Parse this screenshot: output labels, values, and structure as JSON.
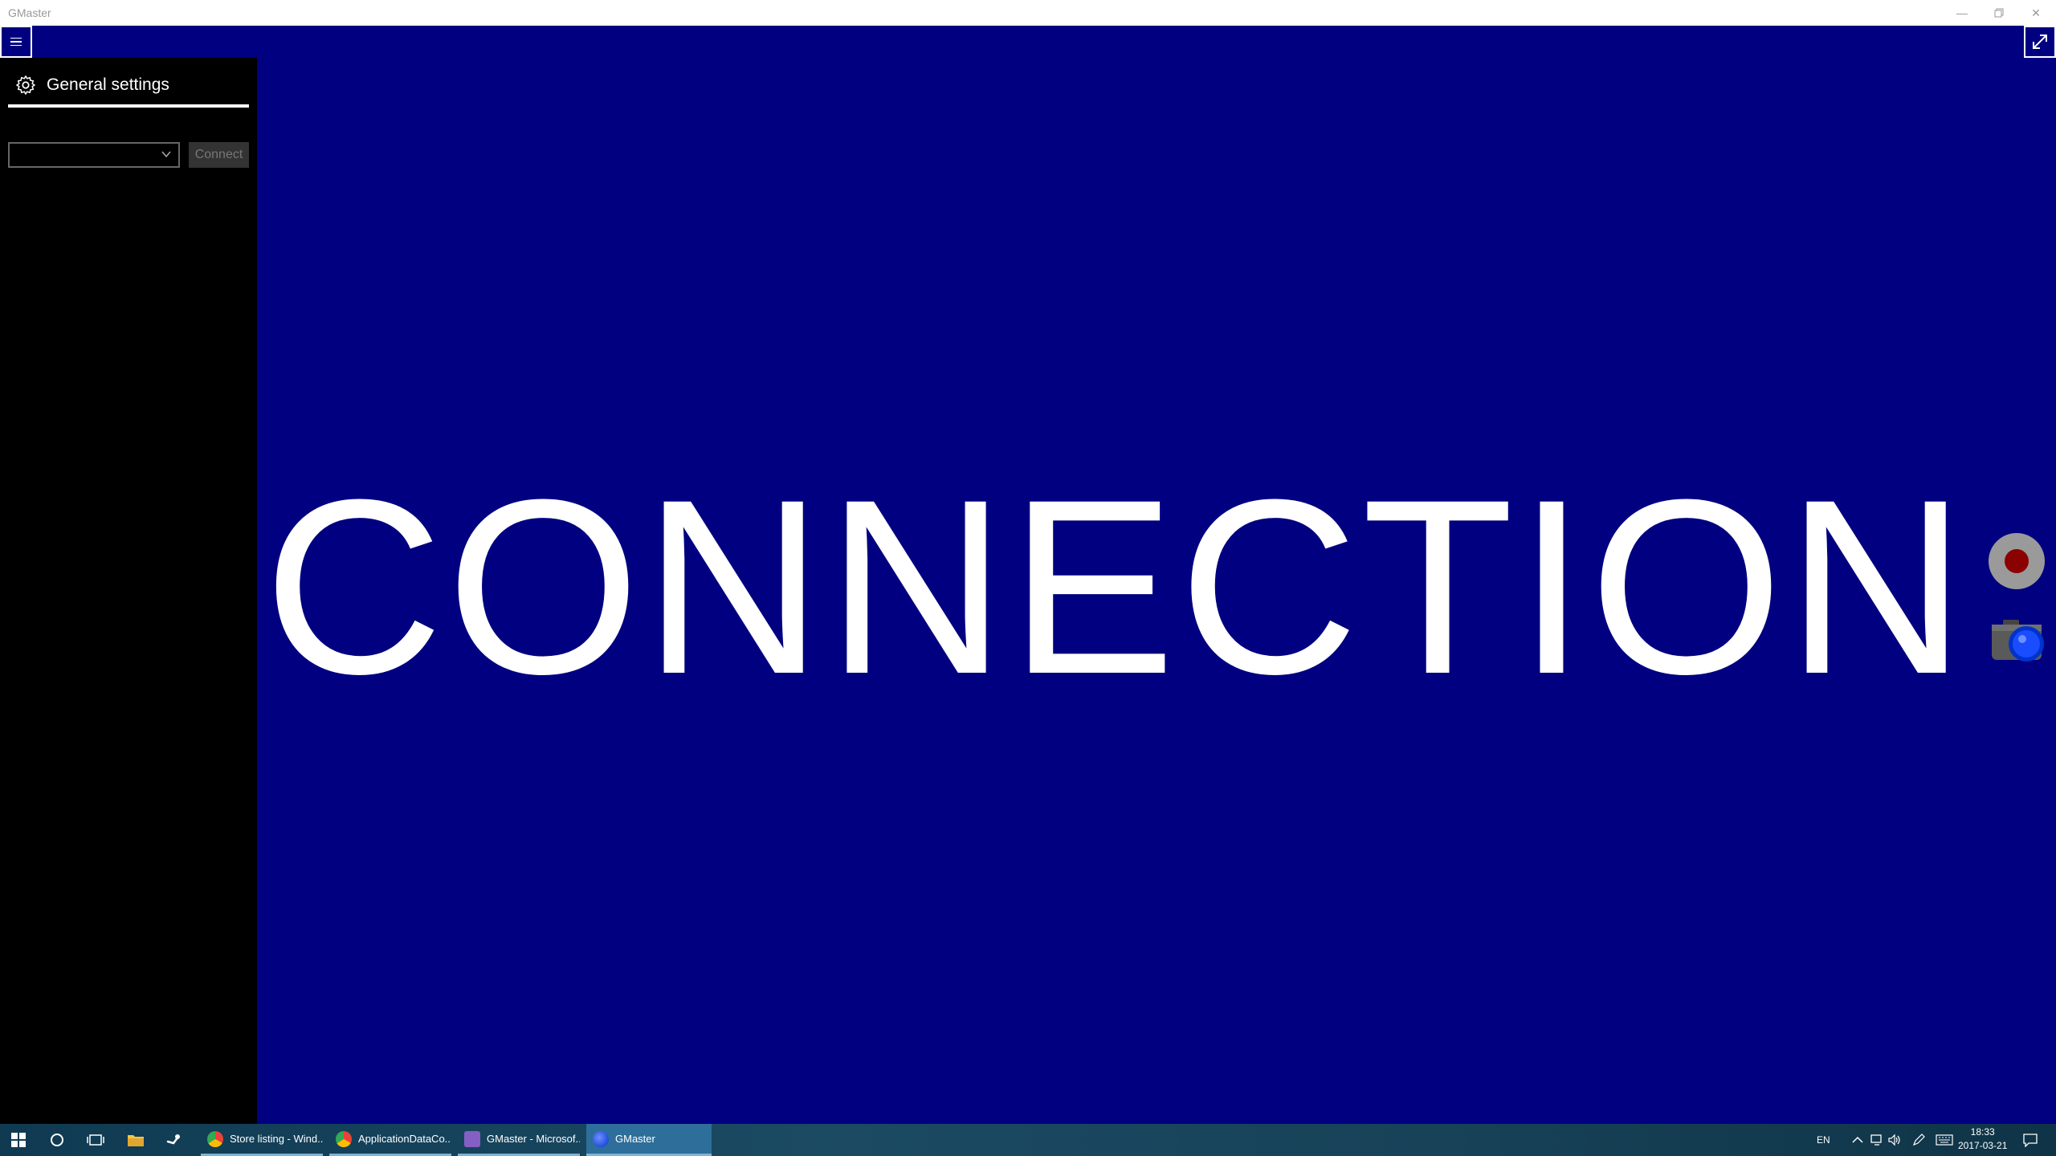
{
  "window": {
    "title": "GMaster",
    "minimize_icon": "minimize-icon",
    "maximize_icon": "restore-icon",
    "close_icon": "close-icon"
  },
  "sidepane": {
    "menu_icon": "hamburger-icon",
    "header_icon": "gear-icon",
    "header_label": "General settings",
    "device_select_value": "",
    "connect_label": "Connect"
  },
  "stage": {
    "status_text": "NO CONNECTION",
    "expand_icon": "expand-icon",
    "record_icon": "record-icon",
    "camera_icon": "camera-icon",
    "background_color": "#000080"
  },
  "taskbar": {
    "apps": [
      {
        "label": "Store listing - Wind...",
        "icon": "chrome-icon"
      },
      {
        "label": "ApplicationDataCo...",
        "icon": "chrome-icon"
      },
      {
        "label": "GMaster - Microsof...",
        "icon": "visual-studio-icon"
      },
      {
        "label": "GMaster",
        "icon": "gmaster-icon",
        "active": true
      }
    ],
    "language": "EN",
    "time": "18:33",
    "date": "2017-03-21"
  }
}
